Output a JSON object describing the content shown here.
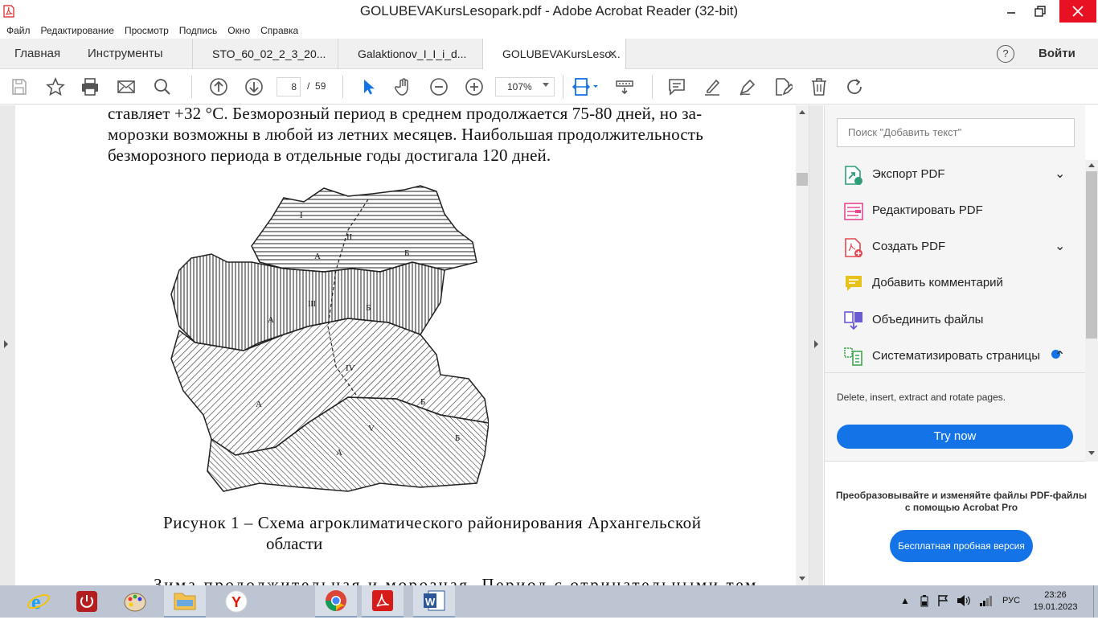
{
  "window": {
    "title": "GOLUBEVAKursLesopark.pdf - Adobe Acrobat Reader (32-bit)"
  },
  "menu": [
    "Файл",
    "Редактирование",
    "Просмотр",
    "Подпись",
    "Окно",
    "Справка"
  ],
  "tabs": {
    "home": "Главная",
    "tools": "Инструменты",
    "documents": [
      "STO_60_02_2_3_20...",
      "Galaktionov_I_I_i_d...",
      "GOLUBEVAKursLeso..."
    ],
    "help": "?",
    "signin": "Войти"
  },
  "toolbar": {
    "page_current": "8",
    "page_separator": "/",
    "page_total": "59",
    "zoom": "107%"
  },
  "document": {
    "lines": [
      "ставляет +32 °С. Безморозный период в среднем продолжается 75-80 дней, но за-",
      "морозки возможны в любой из летних месяцев. Наибольшая продолжительность",
      "безморозного периода в отдельные годы достигала 120 дней."
    ],
    "figure_caption_line1": "Рисунок 1 – Схема агроклиматического районирования Архангельской",
    "figure_caption_line2": "области",
    "partial_line": "Зима продолжительная и морозная. Период с отрицательными тем-",
    "map_labels": {
      "zone_i": "I",
      "zone_ii": "II",
      "zone_iii": "III",
      "zone_iv": "IV",
      "zone_v": "V",
      "sub_a": "А",
      "sub_b": "Б"
    }
  },
  "right_panel": {
    "search_placeholder": "Поиск \"Добавить текст\"",
    "tools": [
      {
        "label": "Экспорт PDF",
        "has_chevron": true,
        "chevron": "⌄",
        "icon": "export-pdf",
        "color": "#2d9d78"
      },
      {
        "label": "Редактировать PDF",
        "has_chevron": false,
        "icon": "edit-pdf",
        "color": "#e34890"
      },
      {
        "label": "Создать PDF",
        "has_chevron": true,
        "chevron": "⌄",
        "icon": "create-pdf",
        "color": "#e34850"
      },
      {
        "label": "Добавить комментарий",
        "has_chevron": false,
        "icon": "comment",
        "color": "#e6c21a"
      },
      {
        "label": "Объединить файлы",
        "has_chevron": false,
        "icon": "combine-files",
        "color": "#6a5ad6"
      },
      {
        "label": "Систематизировать страницы",
        "has_chevron": true,
        "chevron": "⌃",
        "icon": "organize-pages",
        "color": "#3da74e"
      }
    ],
    "organize_description": "Delete, insert, extract and rotate pages.",
    "try_now": "Try now",
    "promo_line1": "Преобразовывайте и изменяйте файлы PDF-файлы",
    "promo_line2": "с помощью Acrobat Pro",
    "trial_button": "Бесплатная пробная версия"
  },
  "taskbar": {
    "language": "РУС",
    "time": "23:26",
    "date": "19.01.2023"
  },
  "colors": {
    "accent": "#1473e6",
    "close": "#e81123",
    "acrobat_red": "#d71a1a"
  }
}
